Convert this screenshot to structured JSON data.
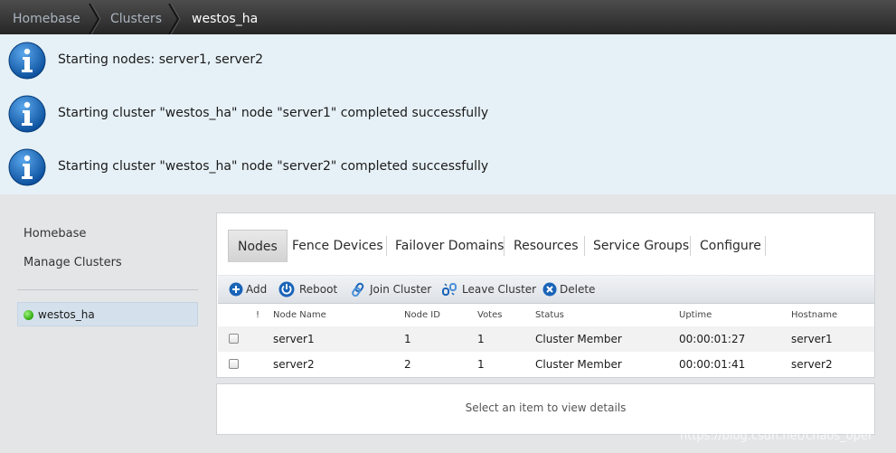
{
  "breadcrumb": [
    "Homebase",
    "Clusters",
    "westos_ha"
  ],
  "notifications": [
    "Starting nodes: server1, server2",
    "Starting cluster \"westos_ha\" node \"server1\" completed successfully",
    "Starting cluster \"westos_ha\" node \"server2\" completed successfully"
  ],
  "sidebar": {
    "links": [
      "Homebase",
      "Manage Clusters"
    ],
    "cluster": {
      "name": "westos_ha",
      "status_color": "#2ea80f"
    }
  },
  "tabs": [
    "Nodes",
    "Fence Devices",
    "Failover Domains",
    "Resources",
    "Service Groups",
    "Configure"
  ],
  "active_tab": "Nodes",
  "toolbar": [
    {
      "label": "Add",
      "icon": "add-icon"
    },
    {
      "label": "Reboot",
      "icon": "power-icon"
    },
    {
      "label": "Join Cluster",
      "icon": "link-icon"
    },
    {
      "label": "Leave Cluster",
      "icon": "unlink-icon"
    },
    {
      "label": "Delete",
      "icon": "delete-icon"
    }
  ],
  "table": {
    "headers": [
      "!",
      "Node Name",
      "Node ID",
      "Votes",
      "Status",
      "Uptime",
      "Hostname"
    ],
    "rows": [
      [
        "server1",
        "1",
        "1",
        "Cluster Member",
        "00:00:01:27",
        "server1"
      ],
      [
        "server2",
        "2",
        "1",
        "Cluster Member",
        "00:00:01:41",
        "server2"
      ]
    ]
  },
  "details_placeholder": "Select an item to view details",
  "watermark": "https://blog.csdn.net/chaos_oper",
  "colors": {
    "accent": "#1560a8",
    "info": "#1a6fc0",
    "notify_bg": "#e6f1f7",
    "header_bg": "#333333"
  }
}
